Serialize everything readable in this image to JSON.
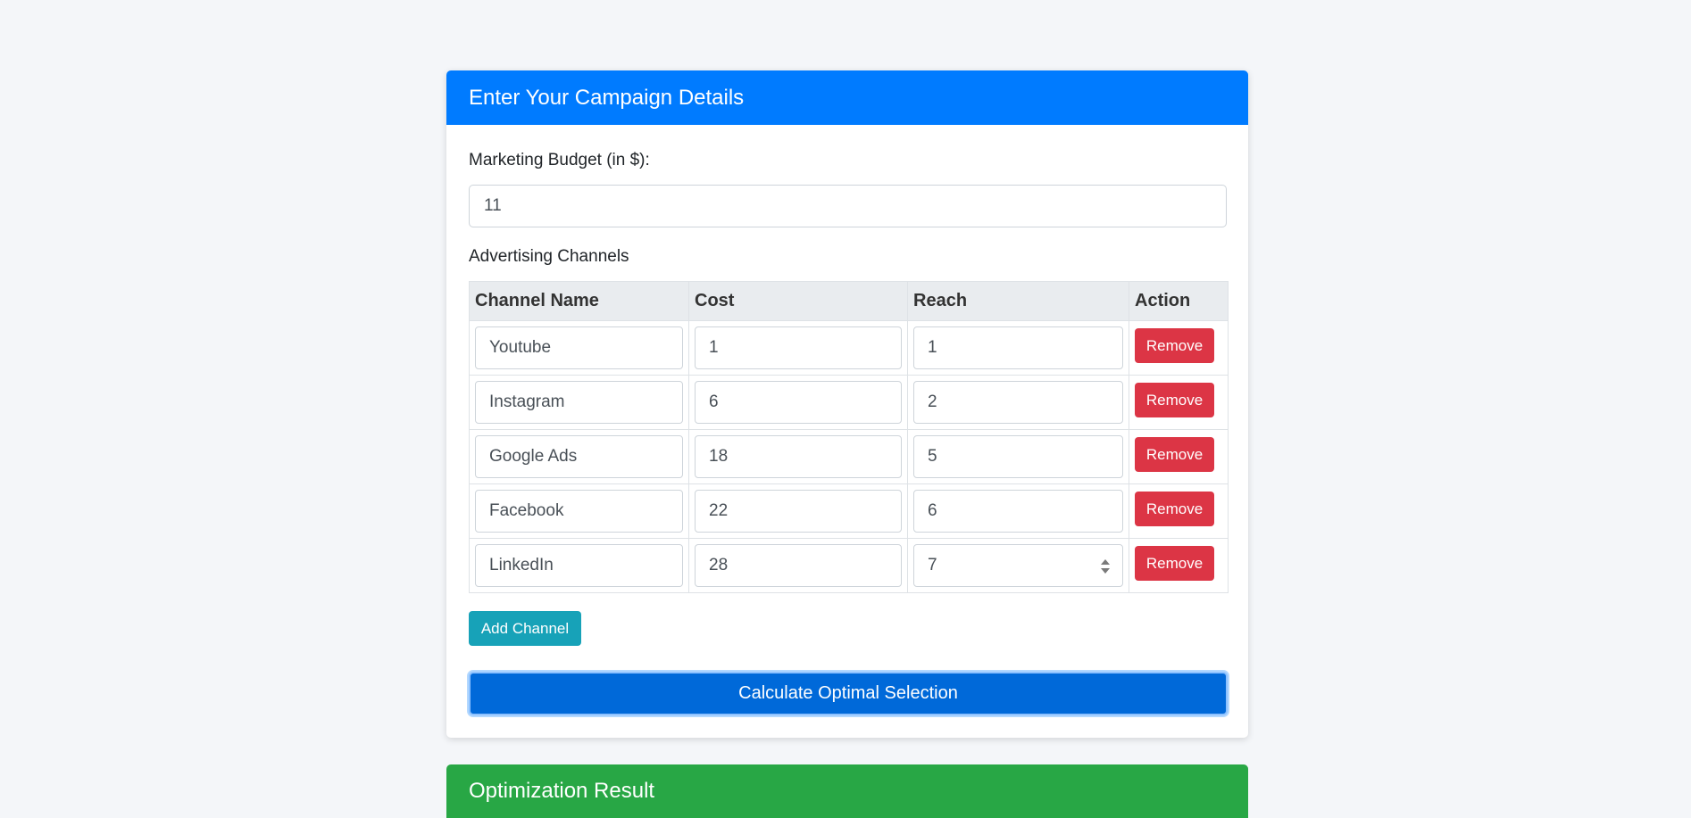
{
  "form": {
    "header_title": "Enter Your Campaign Details",
    "budget_label": "Marketing Budget (in $):",
    "budget_value": "11",
    "channels_label": "Advertising Channels"
  },
  "table": {
    "columns": [
      "Channel Name",
      "Cost",
      "Reach",
      "Action"
    ],
    "rows": [
      {
        "name": "Youtube",
        "cost": "1",
        "reach": "1"
      },
      {
        "name": "Instagram",
        "cost": "6",
        "reach": "2"
      },
      {
        "name": "Google Ads",
        "cost": "18",
        "reach": "5"
      },
      {
        "name": "Facebook",
        "cost": "22",
        "reach": "6"
      },
      {
        "name": "LinkedIn",
        "cost": "28",
        "reach": "7"
      }
    ],
    "remove_label": "Remove"
  },
  "buttons": {
    "add_channel": "Add Channel",
    "calculate": "Calculate Optimal Selection"
  },
  "result": {
    "header_title": "Optimization Result"
  },
  "colors": {
    "primary": "#007bff",
    "danger": "#dc3545",
    "info": "#17a2b8",
    "success": "#28a745"
  }
}
